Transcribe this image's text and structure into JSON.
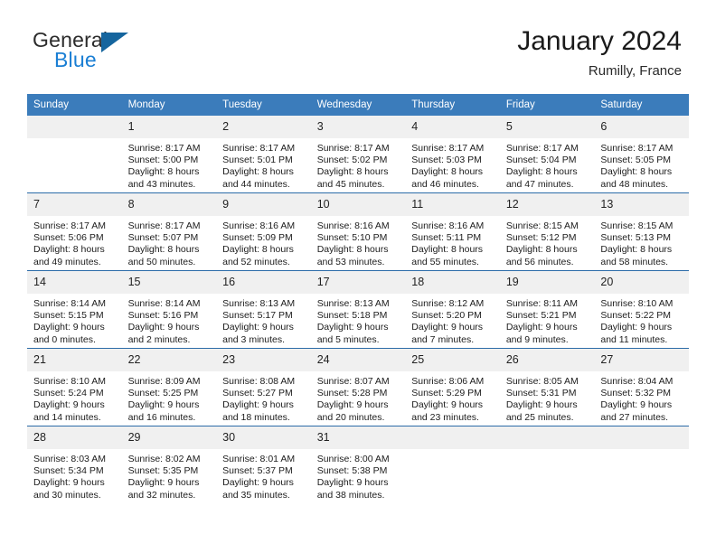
{
  "brand": {
    "name_part1": "General",
    "name_part2": "Blue",
    "flag_icon": "blue-triangle-flag-icon"
  },
  "header": {
    "title": "January 2024",
    "location": "Rumilly, France"
  },
  "theme": {
    "header_blue": "#3b7cbb",
    "separator_blue": "#2c6ca8",
    "daynum_band": "#f0f0f0",
    "brand_blue": "#1b7fd4",
    "flag_blue": "#15659e"
  },
  "calendar": {
    "weekday_headers": [
      "Sunday",
      "Monday",
      "Tuesday",
      "Wednesday",
      "Thursday",
      "Friday",
      "Saturday"
    ],
    "weeks": [
      [
        {
          "day": "",
          "lines": []
        },
        {
          "day": "1",
          "lines": [
            "Sunrise: 8:17 AM",
            "Sunset: 5:00 PM",
            "Daylight: 8 hours",
            "and 43 minutes."
          ]
        },
        {
          "day": "2",
          "lines": [
            "Sunrise: 8:17 AM",
            "Sunset: 5:01 PM",
            "Daylight: 8 hours",
            "and 44 minutes."
          ]
        },
        {
          "day": "3",
          "lines": [
            "Sunrise: 8:17 AM",
            "Sunset: 5:02 PM",
            "Daylight: 8 hours",
            "and 45 minutes."
          ]
        },
        {
          "day": "4",
          "lines": [
            "Sunrise: 8:17 AM",
            "Sunset: 5:03 PM",
            "Daylight: 8 hours",
            "and 46 minutes."
          ]
        },
        {
          "day": "5",
          "lines": [
            "Sunrise: 8:17 AM",
            "Sunset: 5:04 PM",
            "Daylight: 8 hours",
            "and 47 minutes."
          ]
        },
        {
          "day": "6",
          "lines": [
            "Sunrise: 8:17 AM",
            "Sunset: 5:05 PM",
            "Daylight: 8 hours",
            "and 48 minutes."
          ]
        }
      ],
      [
        {
          "day": "7",
          "lines": [
            "Sunrise: 8:17 AM",
            "Sunset: 5:06 PM",
            "Daylight: 8 hours",
            "and 49 minutes."
          ]
        },
        {
          "day": "8",
          "lines": [
            "Sunrise: 8:17 AM",
            "Sunset: 5:07 PM",
            "Daylight: 8 hours",
            "and 50 minutes."
          ]
        },
        {
          "day": "9",
          "lines": [
            "Sunrise: 8:16 AM",
            "Sunset: 5:09 PM",
            "Daylight: 8 hours",
            "and 52 minutes."
          ]
        },
        {
          "day": "10",
          "lines": [
            "Sunrise: 8:16 AM",
            "Sunset: 5:10 PM",
            "Daylight: 8 hours",
            "and 53 minutes."
          ]
        },
        {
          "day": "11",
          "lines": [
            "Sunrise: 8:16 AM",
            "Sunset: 5:11 PM",
            "Daylight: 8 hours",
            "and 55 minutes."
          ]
        },
        {
          "day": "12",
          "lines": [
            "Sunrise: 8:15 AM",
            "Sunset: 5:12 PM",
            "Daylight: 8 hours",
            "and 56 minutes."
          ]
        },
        {
          "day": "13",
          "lines": [
            "Sunrise: 8:15 AM",
            "Sunset: 5:13 PM",
            "Daylight: 8 hours",
            "and 58 minutes."
          ]
        }
      ],
      [
        {
          "day": "14",
          "lines": [
            "Sunrise: 8:14 AM",
            "Sunset: 5:15 PM",
            "Daylight: 9 hours",
            "and 0 minutes."
          ]
        },
        {
          "day": "15",
          "lines": [
            "Sunrise: 8:14 AM",
            "Sunset: 5:16 PM",
            "Daylight: 9 hours",
            "and 2 minutes."
          ]
        },
        {
          "day": "16",
          "lines": [
            "Sunrise: 8:13 AM",
            "Sunset: 5:17 PM",
            "Daylight: 9 hours",
            "and 3 minutes."
          ]
        },
        {
          "day": "17",
          "lines": [
            "Sunrise: 8:13 AM",
            "Sunset: 5:18 PM",
            "Daylight: 9 hours",
            "and 5 minutes."
          ]
        },
        {
          "day": "18",
          "lines": [
            "Sunrise: 8:12 AM",
            "Sunset: 5:20 PM",
            "Daylight: 9 hours",
            "and 7 minutes."
          ]
        },
        {
          "day": "19",
          "lines": [
            "Sunrise: 8:11 AM",
            "Sunset: 5:21 PM",
            "Daylight: 9 hours",
            "and 9 minutes."
          ]
        },
        {
          "day": "20",
          "lines": [
            "Sunrise: 8:10 AM",
            "Sunset: 5:22 PM",
            "Daylight: 9 hours",
            "and 11 minutes."
          ]
        }
      ],
      [
        {
          "day": "21",
          "lines": [
            "Sunrise: 8:10 AM",
            "Sunset: 5:24 PM",
            "Daylight: 9 hours",
            "and 14 minutes."
          ]
        },
        {
          "day": "22",
          "lines": [
            "Sunrise: 8:09 AM",
            "Sunset: 5:25 PM",
            "Daylight: 9 hours",
            "and 16 minutes."
          ]
        },
        {
          "day": "23",
          "lines": [
            "Sunrise: 8:08 AM",
            "Sunset: 5:27 PM",
            "Daylight: 9 hours",
            "and 18 minutes."
          ]
        },
        {
          "day": "24",
          "lines": [
            "Sunrise: 8:07 AM",
            "Sunset: 5:28 PM",
            "Daylight: 9 hours",
            "and 20 minutes."
          ]
        },
        {
          "day": "25",
          "lines": [
            "Sunrise: 8:06 AM",
            "Sunset: 5:29 PM",
            "Daylight: 9 hours",
            "and 23 minutes."
          ]
        },
        {
          "day": "26",
          "lines": [
            "Sunrise: 8:05 AM",
            "Sunset: 5:31 PM",
            "Daylight: 9 hours",
            "and 25 minutes."
          ]
        },
        {
          "day": "27",
          "lines": [
            "Sunrise: 8:04 AM",
            "Sunset: 5:32 PM",
            "Daylight: 9 hours",
            "and 27 minutes."
          ]
        }
      ],
      [
        {
          "day": "28",
          "lines": [
            "Sunrise: 8:03 AM",
            "Sunset: 5:34 PM",
            "Daylight: 9 hours",
            "and 30 minutes."
          ]
        },
        {
          "day": "29",
          "lines": [
            "Sunrise: 8:02 AM",
            "Sunset: 5:35 PM",
            "Daylight: 9 hours",
            "and 32 minutes."
          ]
        },
        {
          "day": "30",
          "lines": [
            "Sunrise: 8:01 AM",
            "Sunset: 5:37 PM",
            "Daylight: 9 hours",
            "and 35 minutes."
          ]
        },
        {
          "day": "31",
          "lines": [
            "Sunrise: 8:00 AM",
            "Sunset: 5:38 PM",
            "Daylight: 9 hours",
            "and 38 minutes."
          ]
        },
        {
          "day": "",
          "lines": []
        },
        {
          "day": "",
          "lines": []
        },
        {
          "day": "",
          "lines": []
        }
      ]
    ]
  }
}
